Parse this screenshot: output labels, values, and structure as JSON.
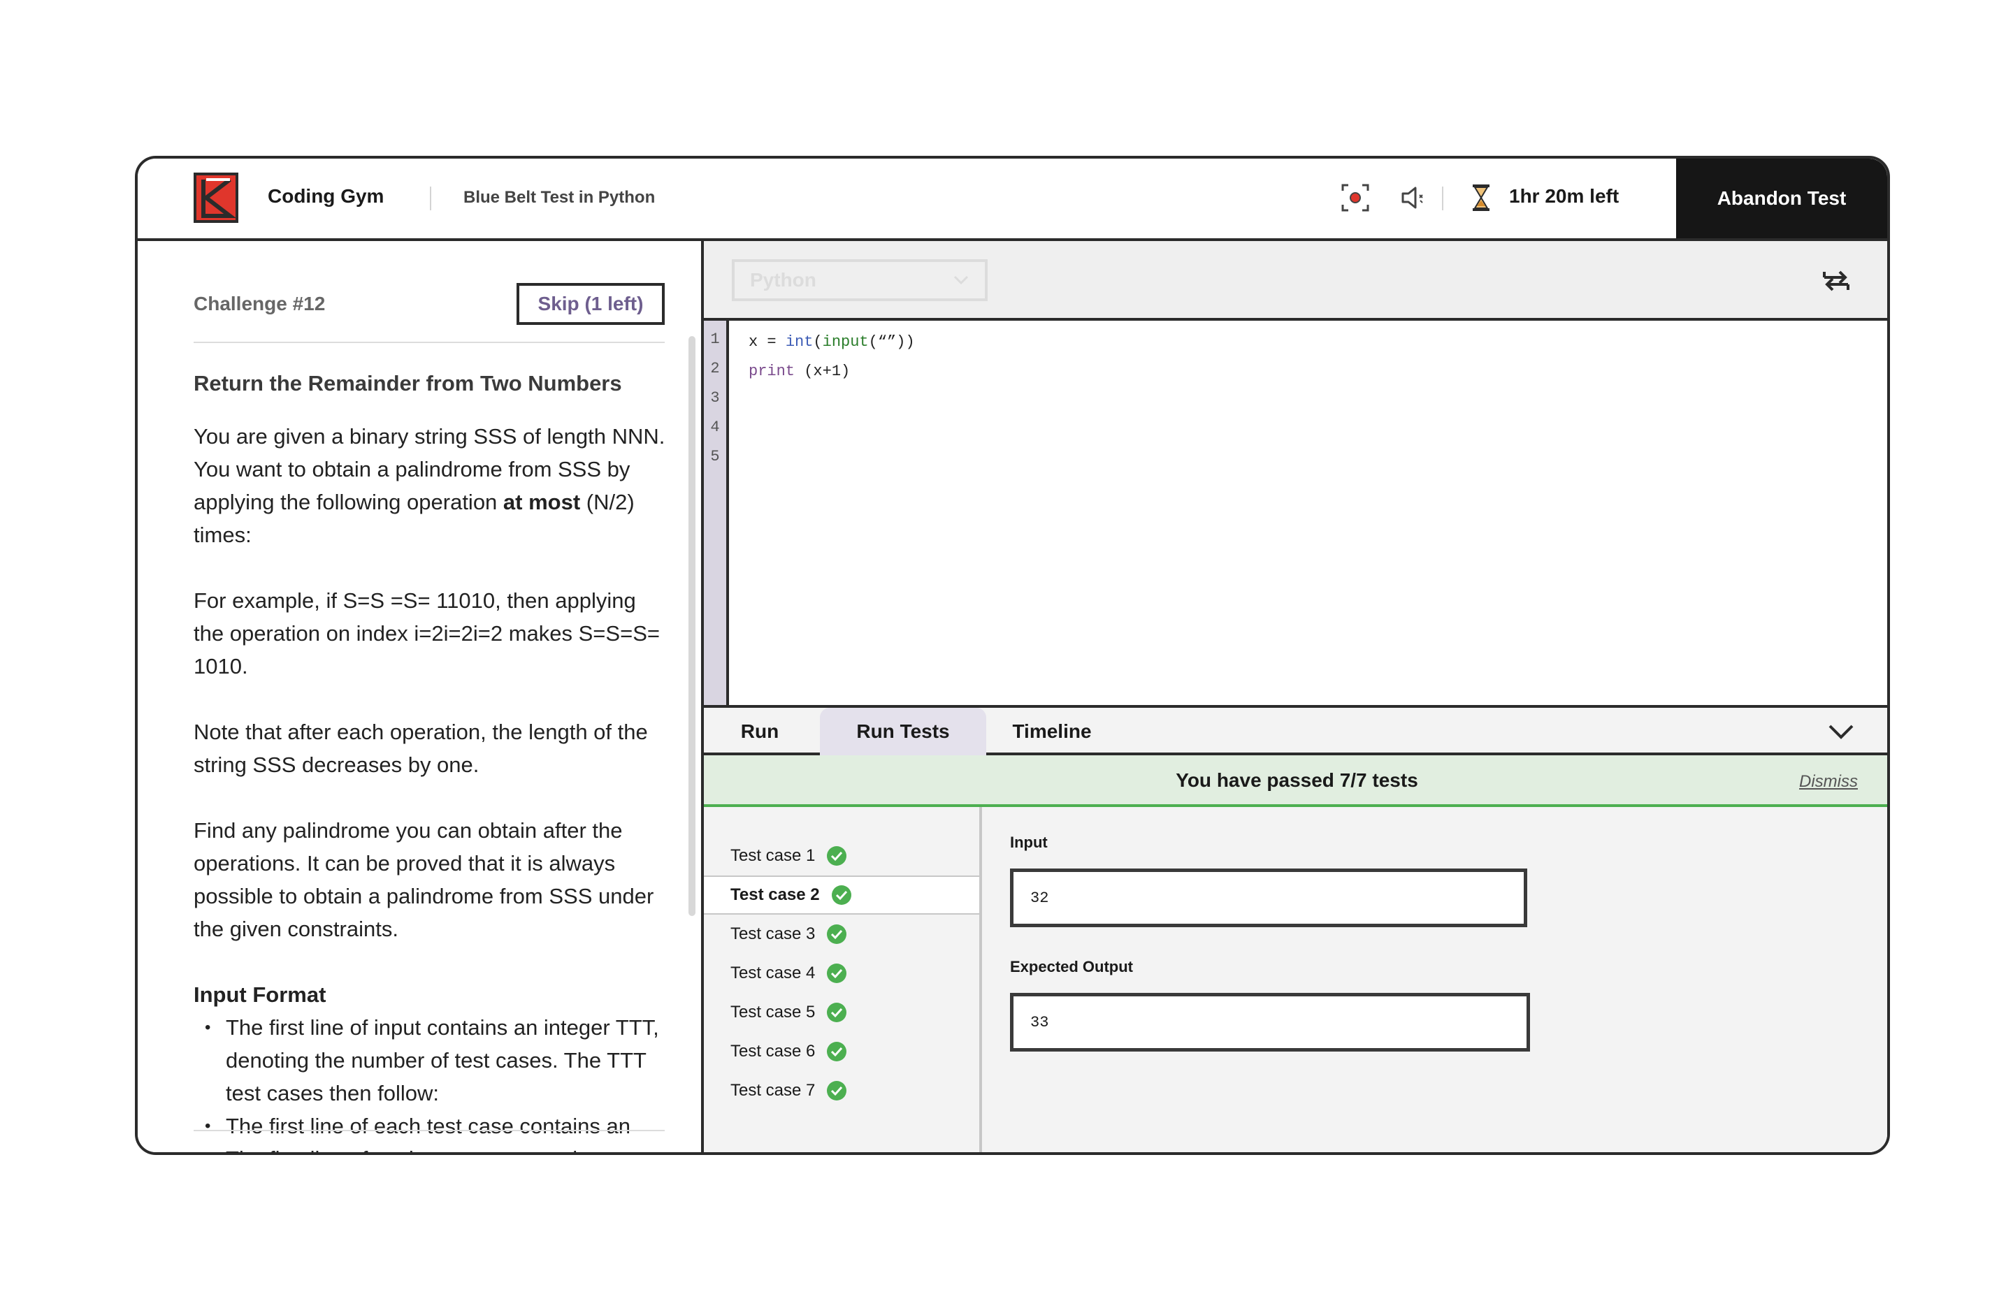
{
  "header": {
    "app_name": "Coding Gym",
    "test_name": "Blue Belt Test in Python",
    "timer": "1hr 20m left",
    "abandon_label": "Abandon Test",
    "icons": [
      "record-icon",
      "mute-icon",
      "hourglass-icon"
    ]
  },
  "challenge": {
    "label": "Challenge #12",
    "skip_label": "Skip (1 left)",
    "title": "Return the Remainder from Two Numbers",
    "p1_a": "You are given a binary string SSS of length NNN. You want to obtain a palindrome from SSS by applying the following operation ",
    "p1_bold": "at most",
    "p1_b": " (N/2) times:",
    "p2": "For example, if S=S =S= 11010, then applying the operation on index i=2i=2i=2 makes S=S=S= 1010.",
    "p3": "Note that after each operation, the length of the string SSS decreases by one.",
    "p4": "Find any palindrome you can obtain after the operations. It can be proved that it is always possible to obtain a palindrome from SSS under the given constraints.",
    "input_format_title": "Input Format",
    "input_format_items": [
      "The first line of input contains an integer TTT, denoting the number of test cases. The TTT test cases then follow:",
      "The first line of each test case contains an",
      "The first line of each test case contains an"
    ]
  },
  "editor": {
    "language": "Python",
    "line_numbers": [
      "1",
      "2",
      "3",
      "4",
      "5"
    ],
    "code": {
      "l1_a": "x = ",
      "l1_int": "int",
      "l1_b": "(",
      "l1_input": "input",
      "l1_c": "(“”))",
      "l2_print": "print",
      "l2_rest": " (x+1)"
    }
  },
  "tabs": {
    "run": "Run",
    "run_tests": "Run Tests",
    "timeline": "Timeline",
    "active": "Run Tests"
  },
  "results": {
    "message": "You have passed 7/7 tests",
    "dismiss": "Dismiss",
    "cases": [
      {
        "label": "Test case 1",
        "passed": true
      },
      {
        "label": "Test case 2",
        "passed": true
      },
      {
        "label": "Test case 3",
        "passed": true
      },
      {
        "label": "Test case 4",
        "passed": true
      },
      {
        "label": "Test case 5",
        "passed": true
      },
      {
        "label": "Test case 6",
        "passed": true
      },
      {
        "label": "Test case 7",
        "passed": true
      }
    ],
    "selected_case": "Test case 2",
    "input_label": "Input",
    "input_value": "32",
    "expected_label": "Expected Output",
    "expected_value": "33"
  },
  "colors": {
    "brand_red": "#e0362c",
    "pass_green": "#4caf50",
    "banner_green": "#e1eee0",
    "active_tab": "#e4e1ec",
    "skip_text": "#6e5e8e"
  }
}
